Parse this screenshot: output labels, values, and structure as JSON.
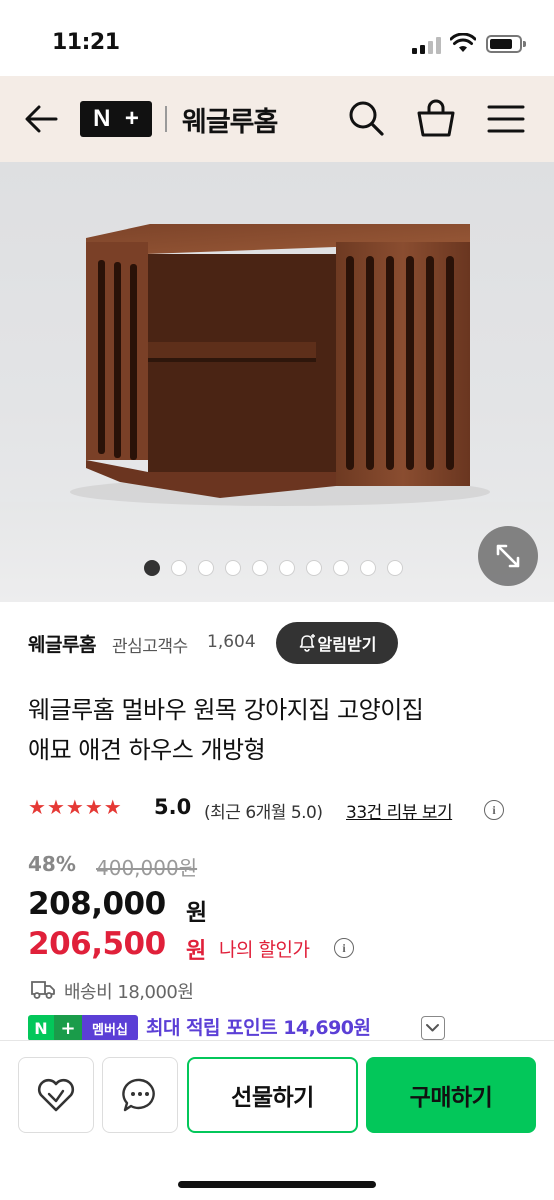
{
  "status": {
    "time": "11:21"
  },
  "header": {
    "logo_n": "N",
    "logo_plus": "+",
    "store_name": "웨글루홈"
  },
  "gallery": {
    "count": 10,
    "active_index": 0
  },
  "store": {
    "name": "웨글루홈",
    "followers_label": "관심고객수",
    "followers_count": "1,604",
    "notify_label": "알림받기"
  },
  "product": {
    "title_line1": "웨글루홈 멀바우 원목 강아지집 고양이집",
    "title_line2": "애묘 애견 하우스 개방형"
  },
  "rating": {
    "stars": 5,
    "star_glyph": "★",
    "value": "5.0",
    "recent": "(최근 6개월 5.0)",
    "reviews_link": "33건 리뷰 보기"
  },
  "price": {
    "discount_rate": "48%",
    "original": "400,000원",
    "sale": "208,000",
    "sale_unit": "원",
    "my_price": "206,500",
    "my_price_unit": "원",
    "my_discount_label": "나의 할인가"
  },
  "shipping": {
    "text": "배송비 18,000원"
  },
  "membership": {
    "badge_n": "N",
    "badge_plus": "+",
    "badge_label": "멤버십",
    "points_text": "최대 적립 포인트 14,690원"
  },
  "bottom": {
    "gift_label": "선물하기",
    "buy_label": "구매하기"
  },
  "info_glyph": "i",
  "colors": {
    "accent_green": "#03c75a",
    "sale_red": "#e0203a",
    "membership_purple": "#5b3fd6",
    "star_red": "#e53935"
  }
}
